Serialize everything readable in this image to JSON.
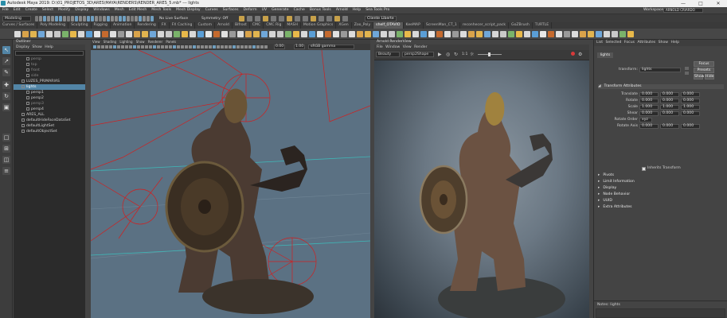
{
  "window": {
    "title": "Autodesk Maya 2019: D:\\01_PROJETOS_3D\\ARES\\MAYA\\RENDERS\\RENDER_ARES_5.mb*   ---   lights",
    "controls": [
      "—",
      "□",
      "✕"
    ]
  },
  "menubar": [
    "File",
    "Edit",
    "Create",
    "Select",
    "Modify",
    "Display",
    "Windows",
    "Mesh",
    "Edit Mesh",
    "Mesh Tools",
    "Mesh Display",
    "Curves",
    "Surfaces",
    "Deform",
    "UV",
    "Generate",
    "Cache",
    "Bonus Tools",
    "Arnold",
    "Help",
    "Sea Tools Pro"
  ],
  "workspace": {
    "label": "Workspace :",
    "value": "ARNOLD CRIARDO"
  },
  "statusline": {
    "mode": "Modeling",
    "no_live_surface": "No Live Surface",
    "symmetry": "Symmetry: Off",
    "user": "Cliente Liberte"
  },
  "shelf_tabs": [
    "Curves / Surfaces",
    "Poly Modeling",
    "Sculpting",
    "Rigging",
    "Animation",
    "Rendering",
    "FX",
    "FX Caching",
    "Custom",
    "Arnold",
    "Bifrost",
    "CMC",
    "CMC Rig",
    "MASH",
    "Motion Graphics",
    "XGen",
    "Zoo_Poly",
    "shelf_OTAVIO",
    "KeeMAP",
    "ScreenMan_CT_1",
    "reconhecer_script_pack",
    "GoZBrush",
    "TURTLE"
  ],
  "shelf_active": "shelf_OTAVIO",
  "outliner": {
    "title": "Outliner",
    "menu": [
      "Display",
      "Show",
      "Help"
    ],
    "rows": [
      {
        "label": "persp",
        "indent": 2,
        "dim": true
      },
      {
        "label": "top",
        "indent": 2,
        "dim": true
      },
      {
        "label": "front",
        "indent": 2,
        "dim": true
      },
      {
        "label": "side",
        "indent": 2,
        "dim": true
      },
      {
        "label": "LUZES_PRIMARIAS",
        "indent": 1,
        "dim": false
      },
      {
        "label": "lights",
        "indent": 1,
        "dim": false,
        "selected": true
      },
      {
        "label": "persp1",
        "indent": 2,
        "dim": false
      },
      {
        "label": "persp2",
        "indent": 2,
        "dim": false
      },
      {
        "label": "persp3",
        "indent": 2,
        "dim": true
      },
      {
        "label": "persp4",
        "indent": 2,
        "dim": false
      },
      {
        "label": "ARES_ALL",
        "indent": 1,
        "dim": false
      },
      {
        "label": "defaultHideFaceDataSet",
        "indent": 1,
        "dim": false
      },
      {
        "label": "defaultLightSet",
        "indent": 1,
        "dim": false
      },
      {
        "label": "defaultObjectSet",
        "indent": 1,
        "dim": false
      }
    ]
  },
  "viewport": {
    "menu": [
      "View",
      "Shading",
      "Lighting",
      "Show",
      "Renderer",
      "Panels"
    ],
    "fields": [
      "0.00",
      "1.00"
    ],
    "colorspace": "sRGB gamma"
  },
  "renderview": {
    "title": "Arnold RenderView",
    "menu": [
      "File",
      "Window",
      "View",
      "Render"
    ],
    "aov": "Beauty",
    "camera": "persp2Shape",
    "ratio": "1:1"
  },
  "attribute_editor": {
    "tabs": [
      "List",
      "Selected",
      "Focus",
      "Attributes",
      "Show",
      "Help"
    ],
    "node_tab": "lights",
    "transform_label": "transform:",
    "transform_value": "lights",
    "buttons": [
      "Focus",
      "Presets",
      "Show",
      "Hide"
    ],
    "section": "Transform Attributes",
    "rows": [
      {
        "label": "Translate",
        "values": [
          "0.000",
          "0.000",
          "0.000"
        ]
      },
      {
        "label": "Rotate",
        "values": [
          "0.000",
          "0.000",
          "0.000"
        ]
      },
      {
        "label": "Scale",
        "values": [
          "1.000",
          "1.000",
          "1.000"
        ]
      },
      {
        "label": "Shear",
        "values": [
          "0.000",
          "0.000",
          "0.000"
        ]
      },
      {
        "label": "Rotate Order",
        "values": [
          "xyz"
        ]
      },
      {
        "label": "Rotate Axis",
        "values": [
          "0.000",
          "0.000",
          "0.000"
        ]
      }
    ],
    "inherits": "Inherits Transform",
    "collapsed": [
      "Pivots",
      "Limit Information",
      "Display",
      "Node Behavior",
      "UUID",
      "Extra Attributes"
    ],
    "notes": "Notes: lights"
  }
}
